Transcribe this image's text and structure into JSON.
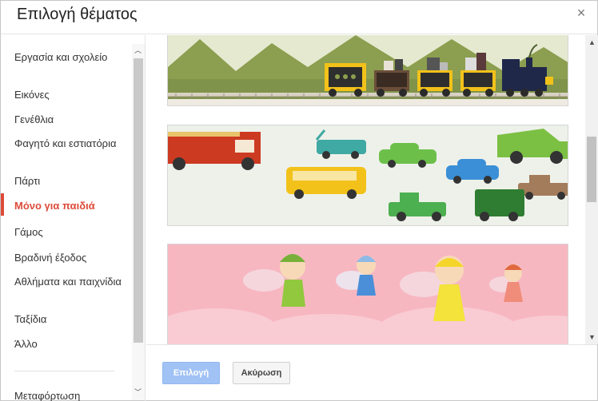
{
  "dialog": {
    "title": "Επιλογή θέματος",
    "close_icon": "close-icon",
    "close_glyph": "×"
  },
  "sidebar": {
    "active_color": "#dd4b39",
    "items": [
      {
        "label": "Εργασία και σχολείο",
        "active": false
      },
      {
        "label": "Εικόνες",
        "active": false
      },
      {
        "label": "Γενέθλια",
        "active": false
      },
      {
        "label": "Φαγητό και εστιατόρια",
        "active": false
      },
      {
        "label": "Πάρτι",
        "active": false
      },
      {
        "label": "Μόνο για παιδιά",
        "active": true
      },
      {
        "label": "Γάμος",
        "active": false
      },
      {
        "label": "Βραδινή έξοδος",
        "active": false
      },
      {
        "label": "Αθλήματα και παιχνίδια",
        "active": false
      },
      {
        "label": "Ταξίδια",
        "active": false
      },
      {
        "label": "Άλλο",
        "active": false
      },
      {
        "label": "Μεταφόρτωση",
        "active": false
      }
    ],
    "scroll_up_glyph": "︿",
    "scroll_down_glyph": "﹀"
  },
  "content": {
    "themes": [
      {
        "name": "train-theme"
      },
      {
        "name": "vehicles-theme"
      },
      {
        "name": "fairies-theme"
      }
    ],
    "scroll_up_glyph": "▲",
    "scroll_down_glyph": "▼"
  },
  "footer": {
    "select_label": "Επιλογή",
    "cancel_label": "Ακύρωση",
    "primary_color": "#a0c2f5"
  }
}
